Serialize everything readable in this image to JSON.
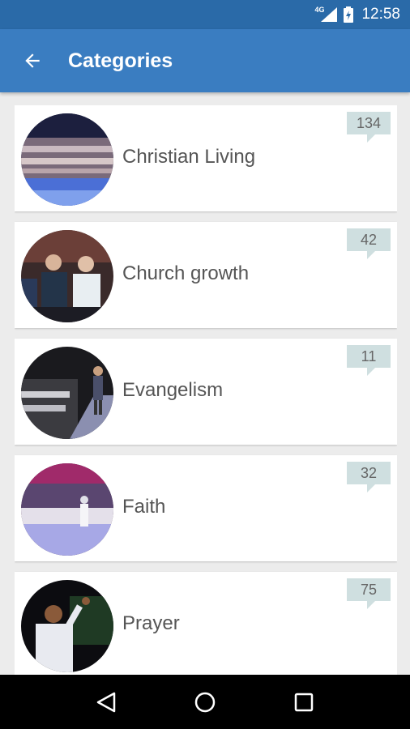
{
  "status_bar": {
    "network": "4G",
    "time": "12:58"
  },
  "app_bar": {
    "title": "Categories"
  },
  "colors": {
    "status_bar": "#2a6aa8",
    "app_bar": "#3a7dc1",
    "badge": "#cfdfe0"
  },
  "categories": [
    {
      "label": "Christian Living",
      "count": "134",
      "thumbnail": "crowd-audience-photo"
    },
    {
      "label": "Church growth",
      "count": "42",
      "thumbnail": "audience-seated-photo"
    },
    {
      "label": "Evangelism",
      "count": "11",
      "thumbnail": "preacher-stage-photo"
    },
    {
      "label": "Faith",
      "count": "32",
      "thumbnail": "stadium-crowd-photo"
    },
    {
      "label": "Prayer",
      "count": "75",
      "thumbnail": "pastor-preaching-photo"
    }
  ]
}
